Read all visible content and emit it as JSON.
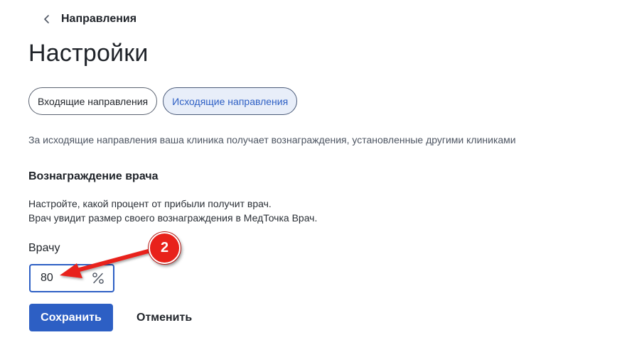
{
  "breadcrumb": {
    "back_label": "Направления"
  },
  "page": {
    "title": "Настройки"
  },
  "tabs": [
    {
      "label": "Входящие направления",
      "active": false
    },
    {
      "label": "Исходящие направления",
      "active": true
    }
  ],
  "description": "За исходящие направления ваша клиника получает вознаграждения, установленные другими клиниками",
  "doctor_reward": {
    "title": "Вознаграждение врача",
    "hint_line1": "Настройте, какой процент от прибыли получит врач.",
    "hint_line2": "Врач увидит размер своего вознаграждения в МедТочка Врач.",
    "field_label": "Врачу",
    "value": "80",
    "unit_icon": "percent-icon"
  },
  "actions": {
    "save_label": "Сохранить",
    "cancel_label": "Отменить"
  },
  "annotation": {
    "badge_number": "2",
    "color": "#e8221b"
  },
  "colors": {
    "accent": "#2d5fc4",
    "active_tab_bg": "#e8eef9",
    "text": "#1f2329",
    "muted_text": "#4d5562"
  },
  "icons": {
    "back": "chevron-left-icon",
    "unit": "percent-icon"
  }
}
